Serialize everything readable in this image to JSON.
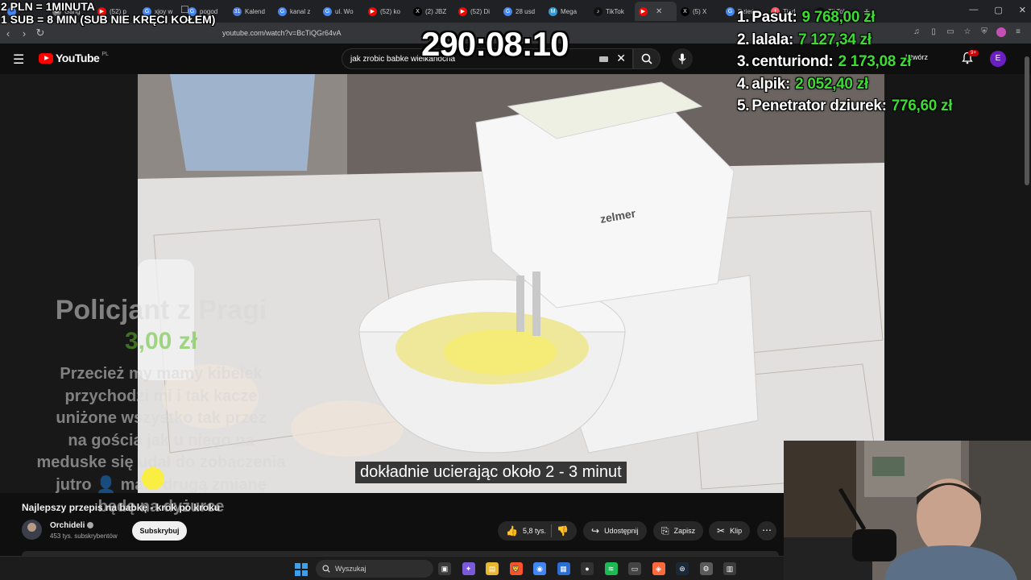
{
  "browser": {
    "tabs": [
      {
        "label": "",
        "color": "#4285f4",
        "glyph": ""
      },
      {
        "label": "Gang",
        "color": "#777777",
        "glyph": "G"
      },
      {
        "label": "(52) p",
        "color": "#ff0000",
        "glyph": "▶"
      },
      {
        "label": "xjoy w",
        "color": "#4285f4",
        "glyph": "G"
      },
      {
        "label": "pogod",
        "color": "#4285f4",
        "glyph": "G"
      },
      {
        "label": "Kalend",
        "color": "#4a76d9",
        "glyph": "31"
      },
      {
        "label": "kanal z",
        "color": "#4285f4",
        "glyph": "G"
      },
      {
        "label": "ul. Wo",
        "color": "#4285f4",
        "glyph": "G"
      },
      {
        "label": "(52) ko",
        "color": "#ff0000",
        "glyph": "▶"
      },
      {
        "label": "(2) JBZ",
        "color": "#000000",
        "glyph": "X"
      },
      {
        "label": "(52) Di",
        "color": "#ff0000",
        "glyph": "▶"
      },
      {
        "label": "28 usd",
        "color": "#4285f4",
        "glyph": "G"
      },
      {
        "label": "Mega",
        "color": "#2f9bd6",
        "glyph": "M"
      },
      {
        "label": "TikTok",
        "color": "#111111",
        "glyph": "♪"
      },
      {
        "label": "",
        "color": "#ff0000",
        "glyph": "▶",
        "active": true
      },
      {
        "label": "(5) X",
        "color": "#000000",
        "glyph": "X"
      },
      {
        "label": "Dzień",
        "color": "#4285f4",
        "glyph": "G"
      },
      {
        "label": "Tind",
        "color": "#ff5864",
        "glyph": "t"
      },
      {
        "label": "TikTok",
        "color": "#111111",
        "glyph": "♪"
      }
    ],
    "new_tab": "+",
    "url": "youtube.com/watch?v=BcTiQGr64vA"
  },
  "youtube": {
    "logo_text": "YouTube",
    "country": "PL",
    "search_value": "jak zrobic babke wielkanocna",
    "create_label": "Utwórz",
    "notifications_badge": "9+",
    "avatar_letter": "E",
    "subtitle": "dokładnie ucierając około 2 - 3 minut",
    "brand_on_mixer": "zelmer",
    "video_title": "Najlepszy przepis na babkę - krok po kroku",
    "channel_name": "Orchideli",
    "subscribers": "453 tys. subskrybentów",
    "subscribe_label": "Subskrybuj",
    "likes": "5,8 tys.",
    "share_label": "Udostępnij",
    "save_label": "Zapisz",
    "clip_label": "Klip",
    "more_label": "⋯"
  },
  "taskbar": {
    "search_placeholder": "Wyszukaj",
    "apps": [
      {
        "name": "task-view-icon",
        "color": "#3a3a3a",
        "glyph": "▣"
      },
      {
        "name": "copilot-icon",
        "color": "#7a5ad8",
        "glyph": "✦"
      },
      {
        "name": "file-explorer-icon",
        "color": "#e8b730",
        "glyph": "▤"
      },
      {
        "name": "brave-icon",
        "color": "#fb542b",
        "glyph": "🦁"
      },
      {
        "name": "chrome-icon",
        "color": "#4285f4",
        "glyph": "◉"
      },
      {
        "name": "store-icon",
        "color": "#2b6fd6",
        "glyph": "▦"
      },
      {
        "name": "app-icon",
        "color": "#333333",
        "glyph": "●"
      },
      {
        "name": "spotify-icon",
        "color": "#1db954",
        "glyph": "≋"
      },
      {
        "name": "monitor-app-icon",
        "color": "#444444",
        "glyph": "▭"
      },
      {
        "name": "browser-icon",
        "color": "#ff6a3d",
        "glyph": "◈"
      },
      {
        "name": "steam-icon",
        "color": "#1b2838",
        "glyph": "⊛"
      },
      {
        "name": "settings-icon",
        "color": "#5a5a5a",
        "glyph": "⚙"
      },
      {
        "name": "calculator-icon",
        "color": "#3c3c3c",
        "glyph": "▥"
      }
    ]
  },
  "overlay": {
    "rate_line1": "2 PLN =  1MINUTA",
    "rate_line2": "1 SUB = 8 MIN (SUB NIE KRĘCI KOŁEM)",
    "timer": "290:08:10",
    "leaderboard": [
      {
        "rank": "1.",
        "name": "Pasut:",
        "amount": "9 768,00 zł"
      },
      {
        "rank": "2.",
        "name": "lalala:",
        "amount": "7 127,34 zł"
      },
      {
        "rank": "3.",
        "name": "centuriond:",
        "amount": "2 173,08 zł"
      },
      {
        "rank": "4.",
        "name": "alpik:",
        "amount": "2 052,40 zł"
      },
      {
        "rank": "5.",
        "name": "Penetrator dziurek:",
        "amount": "776,60 zł"
      }
    ],
    "donation": {
      "name": "Policjant z Pragi",
      "amount": "3,00 zł",
      "message": [
        "Przecież my mamy kibelek",
        "przychodzi mi i tak kacze",
        "uniżone wszystko tak przez",
        "na gościa jak u niego na",
        "meduske się udał do zobaczenia",
        "jutro 👤 mam drugą zmianę",
        "będę na dyżurce"
      ]
    }
  }
}
